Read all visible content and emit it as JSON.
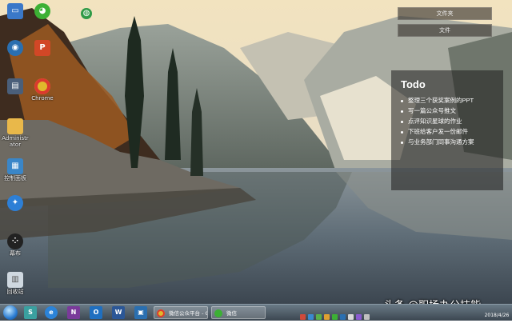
{
  "desktop_icons": [
    {
      "label": "",
      "icon": "computer-icon",
      "color": "#3a78c8"
    },
    {
      "label": "",
      "icon": "wechat-icon",
      "color": "#3cb034"
    },
    {
      "label": "",
      "icon": "globe-icon",
      "color": "#2f9a47"
    },
    {
      "label": "",
      "icon": "network-icon",
      "color": "#2a6fb0"
    },
    {
      "label": "",
      "icon": "powerpoint-icon",
      "color": "#d24726"
    },
    {
      "label": "",
      "icon": "control-icon",
      "color": "#4a5f7a"
    },
    {
      "label": "Chrome",
      "icon": "chrome-icon",
      "color": "#e0b92c"
    },
    {
      "label": "Administrator",
      "icon": "folder-icon",
      "color": "#e9b84a"
    },
    {
      "label": "控制面板",
      "icon": "control-panel-icon",
      "color": "#3a86c8"
    },
    {
      "label": "",
      "icon": "app-icon",
      "color": "#2d7fd6"
    },
    {
      "label": "幕布",
      "icon": "mubu-icon",
      "color": "#222222"
    },
    {
      "label": "回收站",
      "icon": "recycle-bin-icon",
      "color": "#cfd8e0"
    }
  ],
  "folder_panel": {
    "buttons": [
      "文件夹",
      "文件"
    ]
  },
  "todo": {
    "title": "Todo",
    "items": [
      "整理三个获奖案例的PPT",
      "写一篇公众号推文",
      "点评知识星球的作业",
      "下班给客户发一份邮件",
      "与业务部门同事沟通方案"
    ]
  },
  "taskbar": {
    "pinned": [
      {
        "icon": "mixed-app-icon",
        "color": "#3aa0a0",
        "text": "S"
      },
      {
        "icon": "ie-icon",
        "color": "#2b83d8",
        "text": "e"
      },
      {
        "icon": "onenote-icon",
        "color": "#7a3a9a",
        "text": "N"
      },
      {
        "icon": "outlook-icon",
        "color": "#1f6fc0",
        "text": "O"
      },
      {
        "icon": "word-icon",
        "color": "#2b5797",
        "text": "W"
      },
      {
        "icon": "app-icon",
        "color": "#2a6fb0",
        "text": "▣"
      }
    ],
    "tasks": [
      {
        "label": "微信公众平台 - G...",
        "icon": "chrome-icon",
        "color": "#e0b92c"
      },
      {
        "label": "微信",
        "icon": "wechat-icon",
        "color": "#3cb034"
      }
    ],
    "clock_date": "2018/4/26"
  },
  "watermark": "头条 @职场办公技能"
}
